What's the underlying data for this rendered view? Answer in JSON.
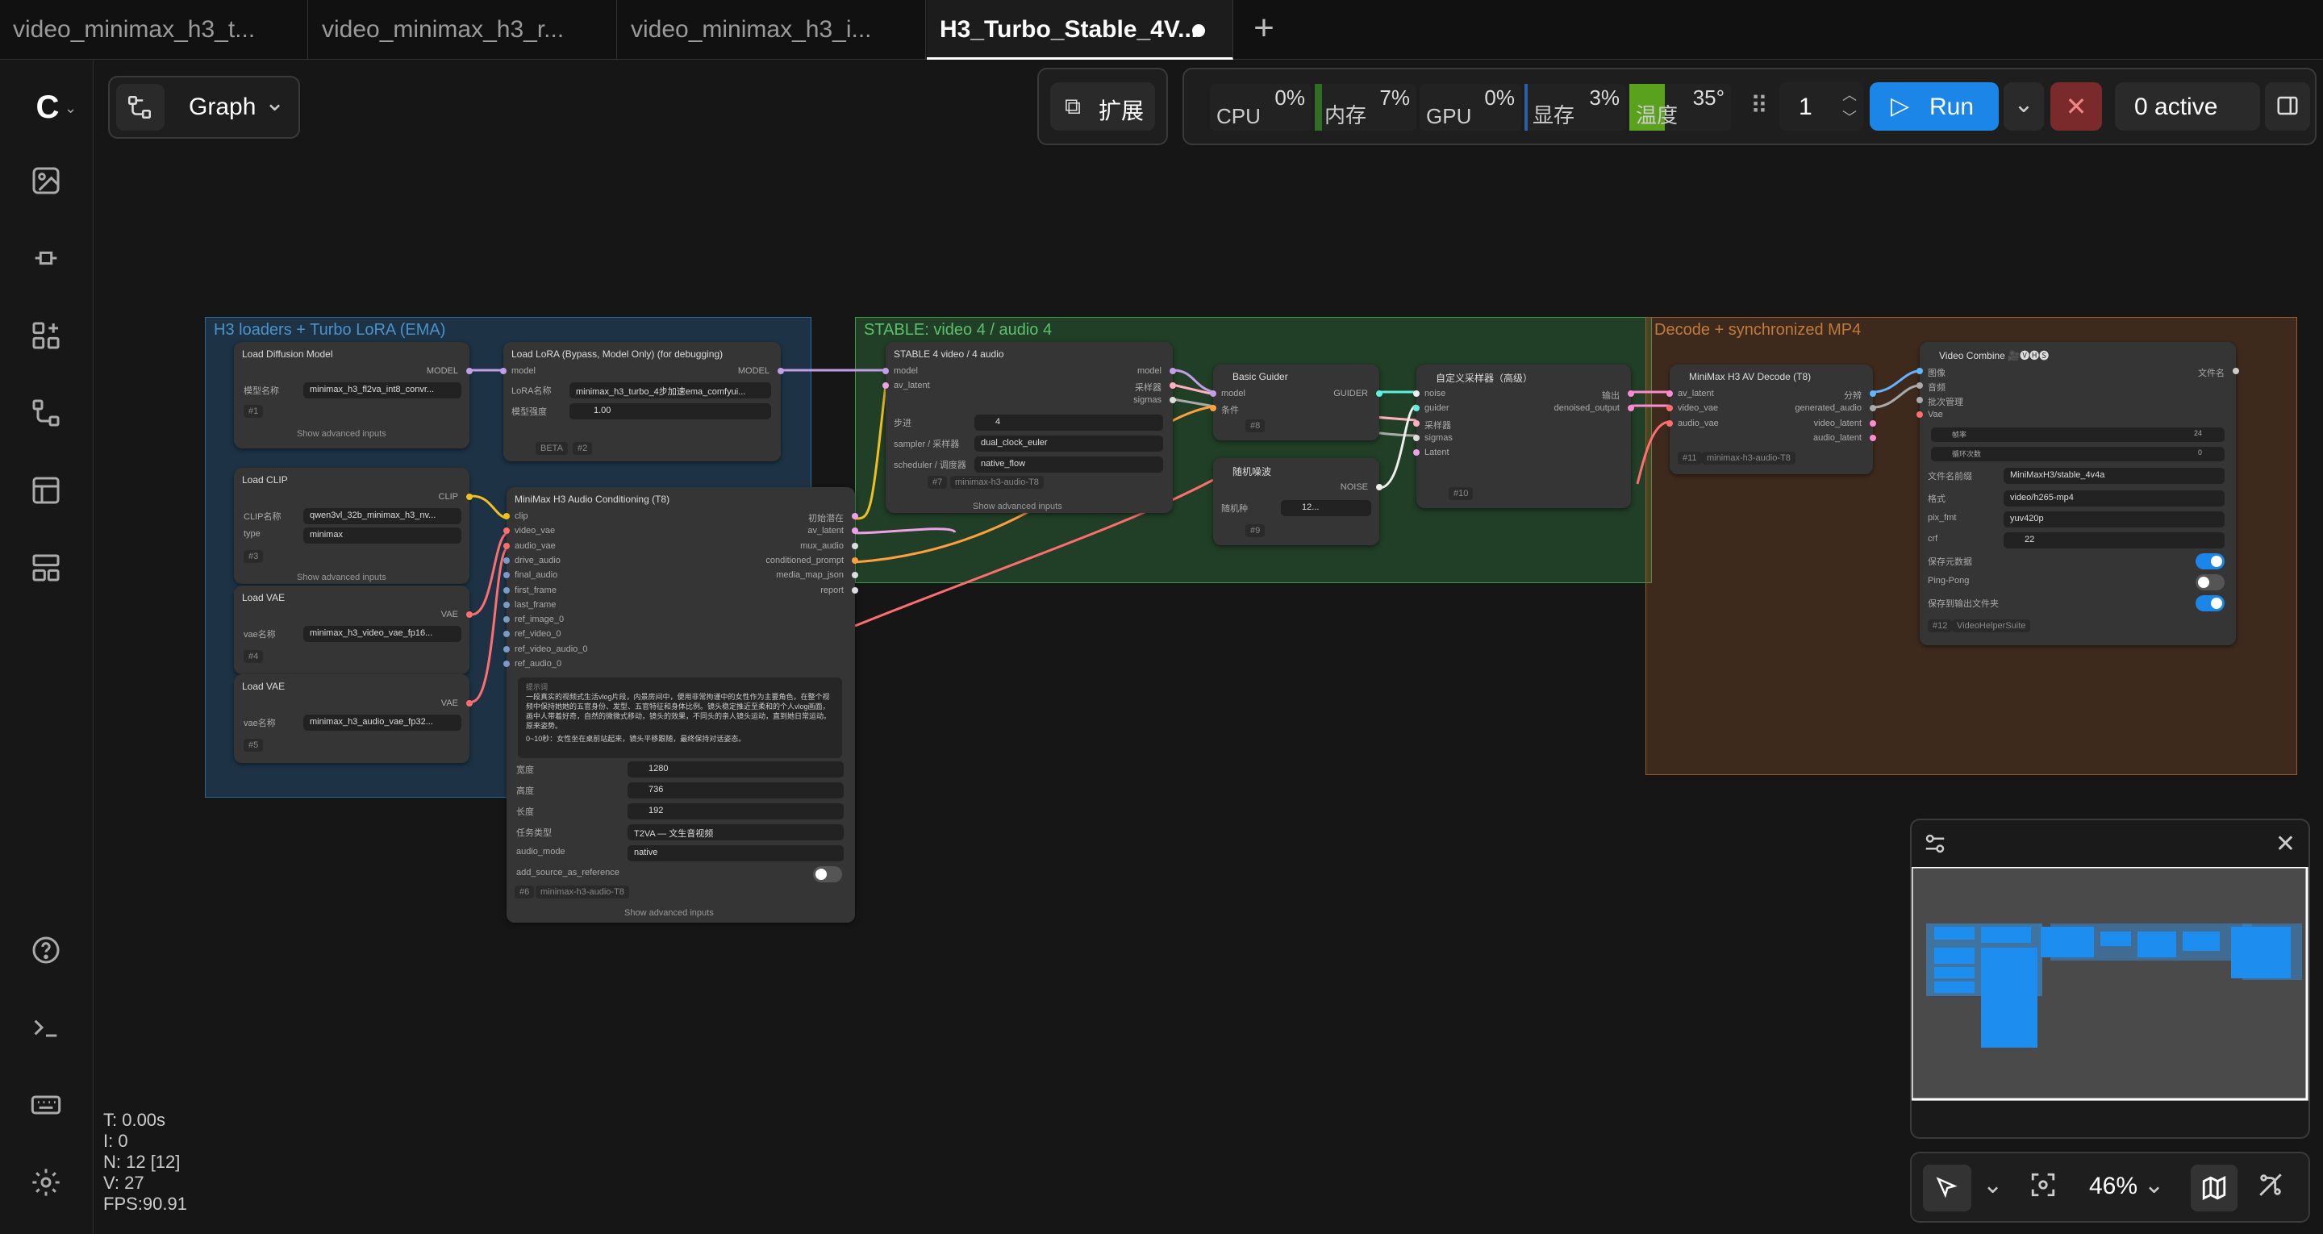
{
  "tabs": [
    {
      "label": "video_minimax_h3_t..."
    },
    {
      "label": "video_minimax_h3_r..."
    },
    {
      "label": "video_minimax_h3_i..."
    },
    {
      "label": "H3_Turbo_Stable_4V..."
    }
  ],
  "header": {
    "graph_label": "Graph",
    "extensions_label": "扩展",
    "run_count": "1",
    "run_label": "Run",
    "active_label": "0 active"
  },
  "stats_bar": {
    "cpu": {
      "label": "CPU",
      "value": "0%"
    },
    "mem": {
      "label": "内存",
      "value": "7%",
      "level": 0.07
    },
    "gpu": {
      "label": "GPU",
      "value": "0%"
    },
    "vram": {
      "label": "显存",
      "value": "3%",
      "level": 0.03
    },
    "temp": {
      "label": "温度",
      "value": "35°",
      "level": 0.35
    }
  },
  "groups": {
    "loaders": {
      "title": "H3 loaders + Turbo LoRA (EMA)",
      "color": "#2a6a9a"
    },
    "stable": {
      "title": "STABLE: video 4 / audio 4",
      "color": "#3a9a4a"
    },
    "decode": {
      "title": "Decode + synchronized MP4",
      "color": "#9a5a2a"
    }
  },
  "nodes": {
    "n1": {
      "title": "Load Diffusion Model",
      "out": "MODEL",
      "w1_label": "模型名称",
      "w1_value": "minimax_h3_fl2va_int8_convr...",
      "id": "#1",
      "adv": "Show advanced inputs"
    },
    "n2": {
      "title": "Load LoRA (Bypass, Model Only) (for debugging)",
      "in": "model",
      "out": "MODEL",
      "w1_label": "LoRA名称",
      "w1_value": "minimax_h3_turbo_4步加速ema_comfyui...",
      "w2_label": "模型强度",
      "w2_value": "1.00",
      "badge": "BETA",
      "id": "#2"
    },
    "n3": {
      "title": "Load CLIP",
      "out": "CLIP",
      "w1_label": "CLIP名称",
      "w1_value": "qwen3vl_32b_minimax_h3_nv...",
      "w2_label": "type",
      "w2_value": "minimax",
      "id": "#3",
      "adv": "Show advanced inputs"
    },
    "n4": {
      "title": "Load VAE",
      "out": "VAE",
      "w1_label": "vae名称",
      "w1_value": "minimax_h3_video_vae_fp16...",
      "id": "#4"
    },
    "n5": {
      "title": "Load VAE",
      "out": "VAE",
      "w1_label": "vae名称",
      "w1_value": "minimax_h3_audio_vae_fp32...",
      "id": "#5"
    },
    "n6": {
      "title": "MiniMax H3 Audio Conditioning (T8)",
      "inputs": [
        "clip",
        "video_vae",
        "audio_vae",
        "drive_audio",
        "final_audio",
        "first_frame",
        "last_frame",
        "ref_image_0",
        "ref_video_0",
        "ref_video_audio_0",
        "ref_audio_0"
      ],
      "outputs": [
        "初始潜在",
        "av_latent",
        "mux_audio",
        "conditioned_prompt",
        "media_map_json",
        "report"
      ],
      "prompt_label": "提示词",
      "prompt_text": "一段真实的视频式生活vlog片段，内景房间中，便用非常拘谨中的女性作为主要角色，在整个视频中保持她她的五官身份、发型、五官特征和身体比例。镜头稳定推近至柔和的个人vlog画面，画中人带着好奇，自然的微微式移动，镜头的效果，不同头的亲人镜头运动，直到她日常运动。原来姿势。",
      "prompt_tail": "0~10秒：女性坐在桌前站起来，镜头平移跟随，最终保持对话姿态。",
      "w_width_label": "宽度",
      "w_width": "1280",
      "w_height_label": "高度",
      "w_height": "736",
      "w_len_label": "长度",
      "w_len": "192",
      "w_task_label": "任务类型",
      "w_task": "T2VA — 文生音视频",
      "w_mode_label": "audio_mode",
      "w_mode": "native",
      "w_ref_label": "add_source_as_reference",
      "id": "#6",
      "tag": "minimax-h3-audio-T8",
      "adv": "Show advanced inputs"
    },
    "n7": {
      "title": "STABLE 4 video / 4 audio",
      "in1": "model",
      "in2": "av_latent",
      "out1": "model",
      "out2": "采样器",
      "out3": "sigmas",
      "w1_label": "步进",
      "w1_value": "4",
      "w2_label": "sampler / 采样器",
      "w2_value": "dual_clock_euler",
      "w3_label": "scheduler / 调度器",
      "w3_value": "native_flow",
      "id": "#7",
      "tag": "minimax-h3-audio-T8",
      "adv": "Show advanced inputs"
    },
    "n8": {
      "title": "Basic Guider",
      "in1": "model",
      "in2": "条件",
      "out": "GUIDER",
      "id": "#8"
    },
    "n9": {
      "title": "随机噪波",
      "out": "NOISE",
      "w1_label": "随机种",
      "w1_value": "12...",
      "id": "#9"
    },
    "n10": {
      "title": "自定义采样器（高级）",
      "inputs": [
        "noise",
        "guider",
        "采样器",
        "sigmas",
        "Latent"
      ],
      "outputs": [
        "输出",
        "denoised_output"
      ],
      "id": "#10"
    },
    "n11": {
      "title": "MiniMax H3 AV Decode (T8)",
      "inputs": [
        "av_latent",
        "video_vae",
        "audio_vae"
      ],
      "outputs": [
        "分辨",
        "generated_audio",
        "video_latent",
        "audio_latent"
      ],
      "id": "#11",
      "tag": "minimax-h3-audio-T8"
    },
    "n12": {
      "title": "Video Combine 🎥🅥🅗🅢",
      "inputs": [
        "图像",
        "音频",
        "批次管理",
        "Vae"
      ],
      "out": "文件名",
      "slider1_label": "帧率",
      "slider1_value": "24",
      "slider2_label": "循环次数",
      "slider2_value": "0",
      "w_prefix_label": "文件名前缀",
      "w_prefix": "MiniMaxH3/stable_4v4a",
      "w_fmt_label": "格式",
      "w_fmt": "video/h265-mp4",
      "w_pix_label": "pix_fmt",
      "w_pix": "yuv420p",
      "w_crf_label": "crf",
      "w_crf": "22",
      "t1_label": "保存元数据",
      "t2_label": "Ping-Pong",
      "t3_label": "保存到输出文件夹",
      "id": "#12",
      "tag": "VideoHelperSuite"
    }
  },
  "canvas_stats": {
    "t": "T: 0.00s",
    "i": "I: 0",
    "n": "N: 12 [12]",
    "v": "V: 27",
    "fps": "FPS:90.91"
  },
  "zoom": {
    "label": "46%"
  }
}
